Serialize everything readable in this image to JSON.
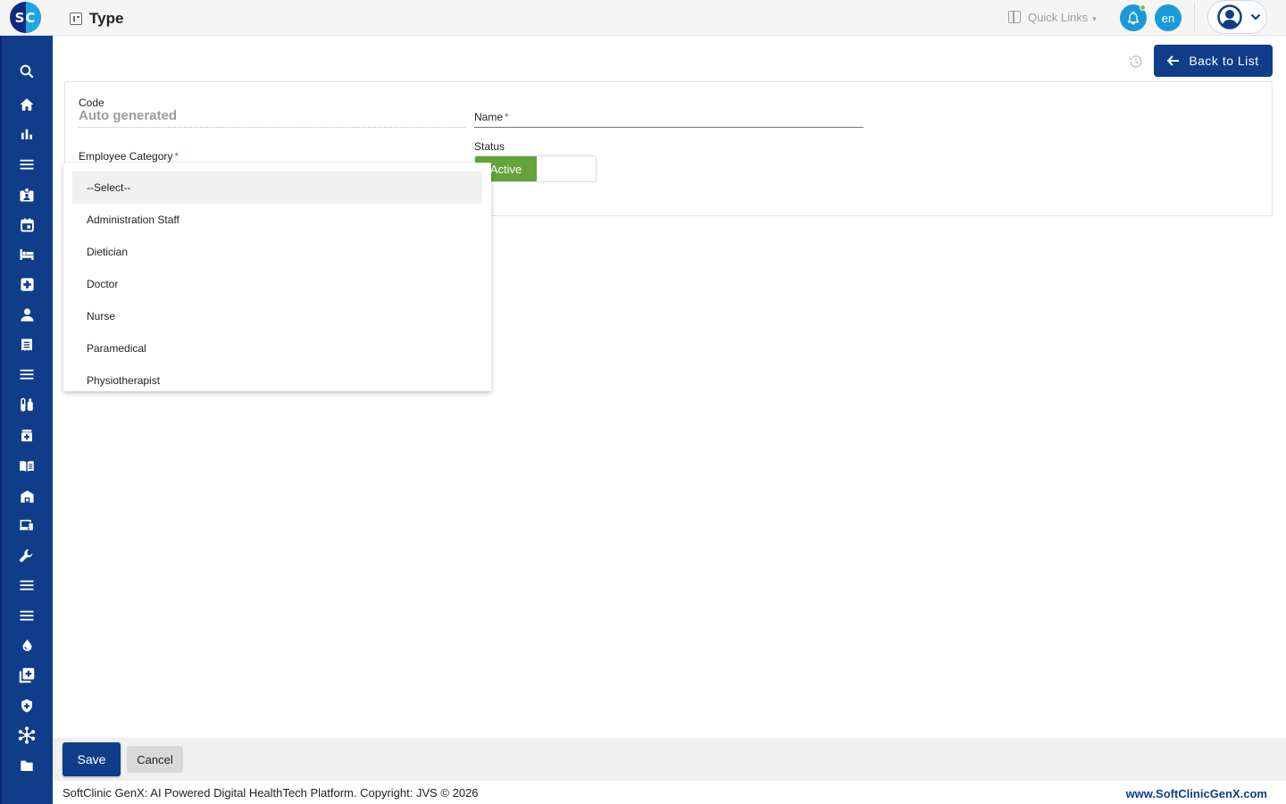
{
  "app": {
    "logo_text": "SC",
    "page_title": "Type"
  },
  "header": {
    "quick_links_label": "Quick Links",
    "language_label": "en"
  },
  "sidebar": {
    "items": [
      {
        "icon": "search-icon"
      },
      {
        "icon": "home-icon"
      },
      {
        "icon": "bar-chart-icon"
      },
      {
        "icon": "menu-icon"
      },
      {
        "icon": "id-badge-icon"
      },
      {
        "icon": "calendar-icon"
      },
      {
        "icon": "bed-icon"
      },
      {
        "icon": "medical-cross-icon"
      },
      {
        "icon": "person-icon"
      },
      {
        "icon": "receipt-icon"
      },
      {
        "icon": "menu-icon"
      },
      {
        "icon": "lab-tubes-icon"
      },
      {
        "icon": "pill-bottle-icon"
      },
      {
        "icon": "book-icon"
      },
      {
        "icon": "building-icon"
      },
      {
        "icon": "devices-icon"
      },
      {
        "icon": "wrench-icon"
      },
      {
        "icon": "menu-icon"
      },
      {
        "icon": "menu-icon"
      },
      {
        "icon": "blood-drop-icon"
      },
      {
        "icon": "add-library-icon"
      },
      {
        "icon": "shield-icon"
      },
      {
        "icon": "network-icon"
      },
      {
        "icon": "folder-icon"
      }
    ]
  },
  "toolbar": {
    "back_label": "Back to List"
  },
  "form": {
    "code_label": "Code",
    "code_value": "Auto generated",
    "name_label": "Name",
    "required_mark": "*",
    "category_label": "Employee Category",
    "status_label": "Status",
    "status_value": "Active"
  },
  "dropdown": {
    "options": [
      "--Select--",
      "Administration Staff",
      "Dietician",
      "Doctor",
      "Nurse",
      "Paramedical",
      "Physiotherapist"
    ],
    "selected": "--Select--"
  },
  "actions": {
    "save_label": "Save",
    "cancel_label": "Cancel"
  },
  "footer": {
    "copyright": "SoftClinic GenX: AI Powered Digital HealthTech Platform. Copyright: JVS © 2026",
    "website": "www.SoftClinicGenX.com"
  },
  "colors": {
    "primary": "#0f3d8a",
    "accent": "#1a9bd7",
    "status_active": "#66a33a",
    "required": "#e53935"
  }
}
